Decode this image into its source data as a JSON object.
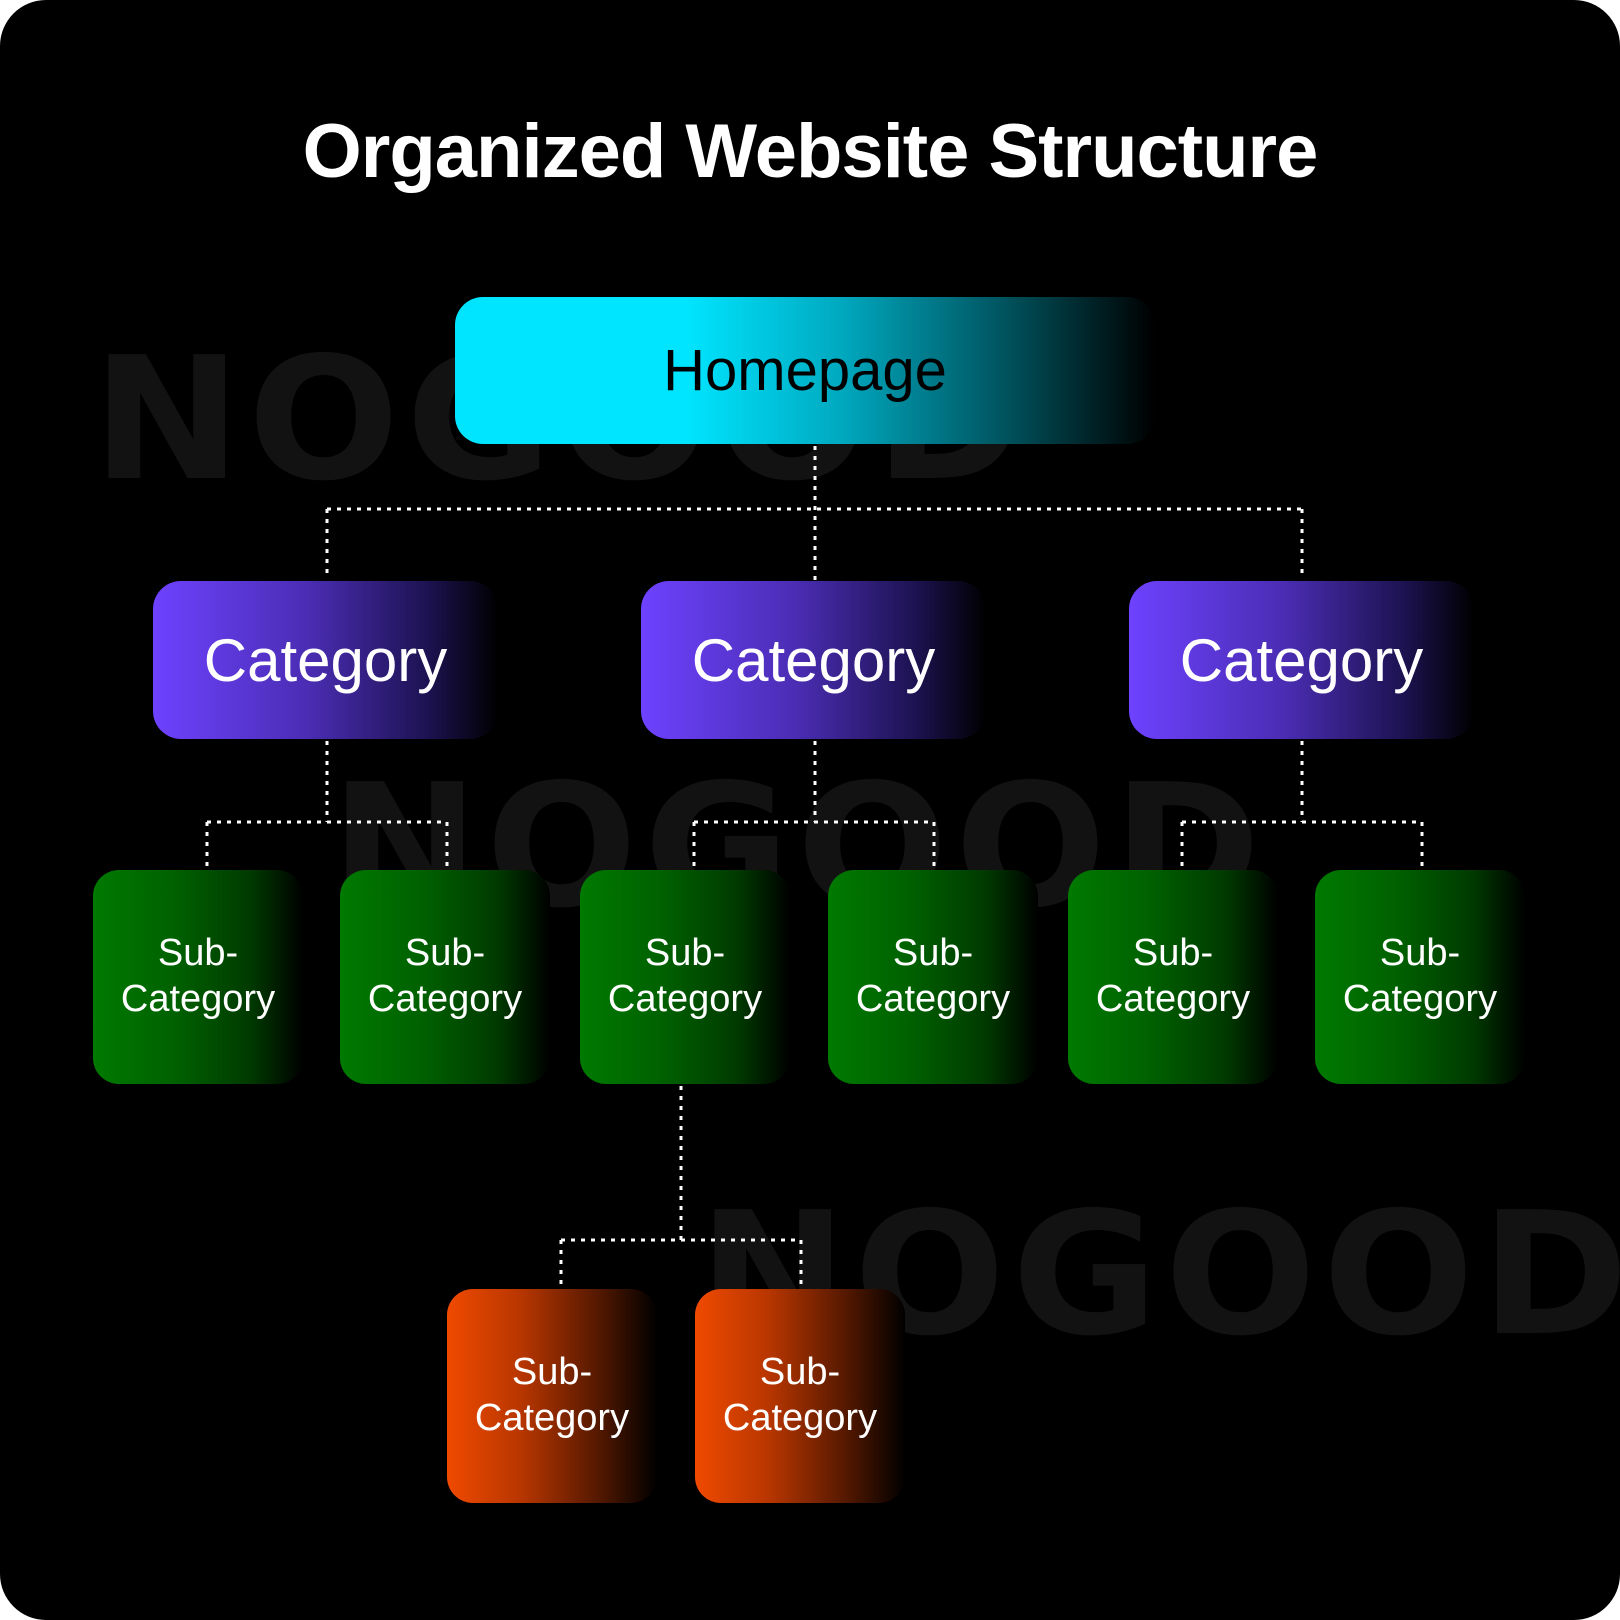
{
  "title": "Organized Website Structure",
  "watermark": "NOGOOD",
  "colors": {
    "background": "#000000",
    "homepage": "#00e5ff",
    "category": "#6e42ff",
    "subcategory": "#007a00",
    "subsubcategory": "#f04a00",
    "connector": "#ffffff"
  },
  "homepage": {
    "label": "Homepage"
  },
  "categories": [
    {
      "label": "Category"
    },
    {
      "label": "Category"
    },
    {
      "label": "Category"
    }
  ],
  "subcategories": [
    {
      "label": "Sub-\nCategory",
      "line1": "Sub-",
      "line2": "Category",
      "parent": 0
    },
    {
      "label": "Sub-\nCategory",
      "line1": "Sub-",
      "line2": "Category",
      "parent": 0
    },
    {
      "label": "Sub-\nCategory",
      "line1": "Sub-",
      "line2": "Category",
      "parent": 1
    },
    {
      "label": "Sub-\nCategory",
      "line1": "Sub-",
      "line2": "Category",
      "parent": 1
    },
    {
      "label": "Sub-\nCategory",
      "line1": "Sub-",
      "line2": "Category",
      "parent": 2
    },
    {
      "label": "Sub-\nCategory",
      "line1": "Sub-",
      "line2": "Category",
      "parent": 2
    }
  ],
  "subsubcategories": [
    {
      "line1": "Sub-",
      "line2": "Category",
      "parent": 2
    },
    {
      "line1": "Sub-",
      "line2": "Category",
      "parent": 2
    }
  ]
}
